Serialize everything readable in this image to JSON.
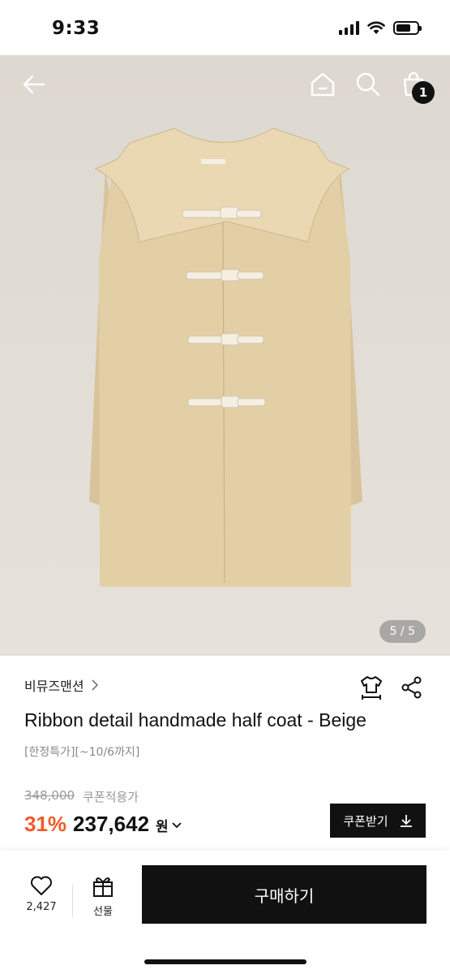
{
  "status_bar": {
    "time": "9:33"
  },
  "gallery": {
    "page_indicator": "5 / 5"
  },
  "header": {
    "cart_count": "1"
  },
  "product": {
    "brand": "비뮤즈맨션",
    "title": "Ribbon detail handmade half coat - Beige",
    "promo": "[한정특가][~10/6까지]",
    "original_price": "348,000",
    "coupon_price_label": "쿠폰적용가",
    "discount": "31%",
    "sale_price": "237,642",
    "currency": "원"
  },
  "coupon_button": {
    "label": "쿠폰받기"
  },
  "bottom_bar": {
    "like_count": "2,427",
    "gift_label": "선물",
    "buy_label": "구매하기"
  },
  "colors": {
    "accent_discount": "#f05a28",
    "coat": "#e3cfa6",
    "background": "#ddd8d1"
  },
  "icons": [
    "back-arrow-icon",
    "home-icon",
    "search-icon",
    "shopping-bag-icon",
    "hanger-shirt-icon",
    "share-icon",
    "heart-icon",
    "gift-icon",
    "download-icon",
    "chevron-right-icon",
    "chevron-down-icon"
  ]
}
